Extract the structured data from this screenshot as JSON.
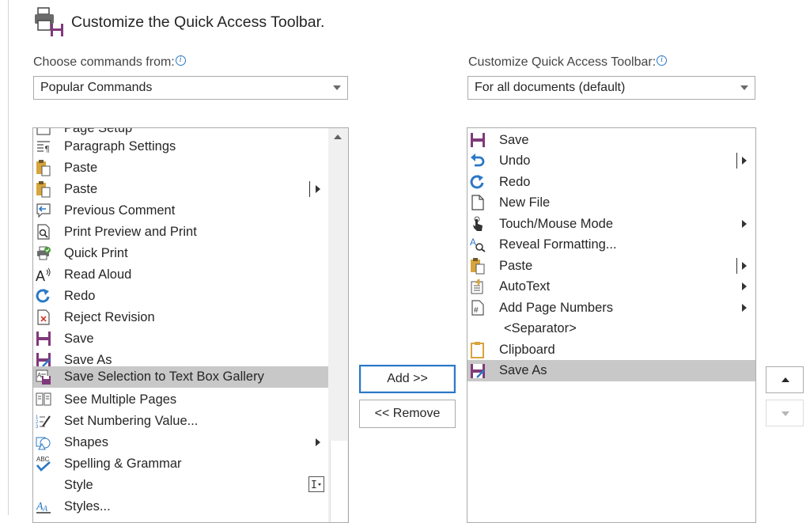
{
  "header": {
    "title": "Customize the Quick Access Toolbar."
  },
  "left": {
    "label": "Choose commands from:",
    "dropdown_value": "Popular Commands",
    "items": [
      {
        "label": "Page Setup",
        "icon": "page-setup-icon"
      },
      {
        "label": "Paragraph Settings",
        "icon": "paragraph-settings-icon"
      },
      {
        "label": "Paste",
        "icon": "paste-icon"
      },
      {
        "label": "Paste",
        "icon": "paste-icon"
      },
      {
        "label": "Previous Comment",
        "icon": "previous-comment-icon"
      },
      {
        "label": "Print Preview and Print",
        "icon": "print-preview-icon"
      },
      {
        "label": "Quick Print",
        "icon": "quick-print-icon"
      },
      {
        "label": "Read Aloud",
        "icon": "read-aloud-icon"
      },
      {
        "label": "Redo",
        "icon": "redo-icon"
      },
      {
        "label": "Reject Revision",
        "icon": "reject-revision-icon"
      },
      {
        "label": "Save",
        "icon": "save-icon"
      },
      {
        "label": "Save As",
        "icon": "save-as-icon"
      },
      {
        "label": "Save Selection to Text Box Gallery",
        "icon": "save-selection-icon"
      },
      {
        "label": "See Multiple Pages",
        "icon": "multiple-pages-icon"
      },
      {
        "label": "Set Numbering Value...",
        "icon": "numbering-icon"
      },
      {
        "label": "Shapes",
        "icon": "shapes-icon"
      },
      {
        "label": "Spelling & Grammar",
        "icon": "spelling-icon"
      },
      {
        "label": "Style",
        "icon": ""
      },
      {
        "label": "Styles...",
        "icon": "styles-icon"
      }
    ]
  },
  "right": {
    "label": "Customize Quick Access Toolbar:",
    "dropdown_value": "For all documents (default)",
    "items": [
      {
        "label": "Save",
        "icon": "save-icon"
      },
      {
        "label": "Undo",
        "icon": "undo-icon"
      },
      {
        "label": "Redo",
        "icon": "redo-icon"
      },
      {
        "label": "New File",
        "icon": "new-file-icon"
      },
      {
        "label": "Touch/Mouse Mode",
        "icon": "touch-mode-icon"
      },
      {
        "label": "Reveal Formatting...",
        "icon": "reveal-formatting-icon"
      },
      {
        "label": "Paste",
        "icon": "paste-icon"
      },
      {
        "label": "AutoText",
        "icon": "autotext-icon"
      },
      {
        "label": "Add Page Numbers",
        "icon": "page-numbers-icon"
      },
      {
        "label": "<Separator>",
        "icon": ""
      },
      {
        "label": "Clipboard",
        "icon": "clipboard-icon"
      },
      {
        "label": "Save As",
        "icon": "save-as-icon"
      }
    ]
  },
  "buttons": {
    "add": "Add >>",
    "remove": "<< Remove"
  },
  "colors": {
    "purple": "#80397b",
    "blue": "#2b78c5",
    "selection": "#c8c8c8"
  }
}
